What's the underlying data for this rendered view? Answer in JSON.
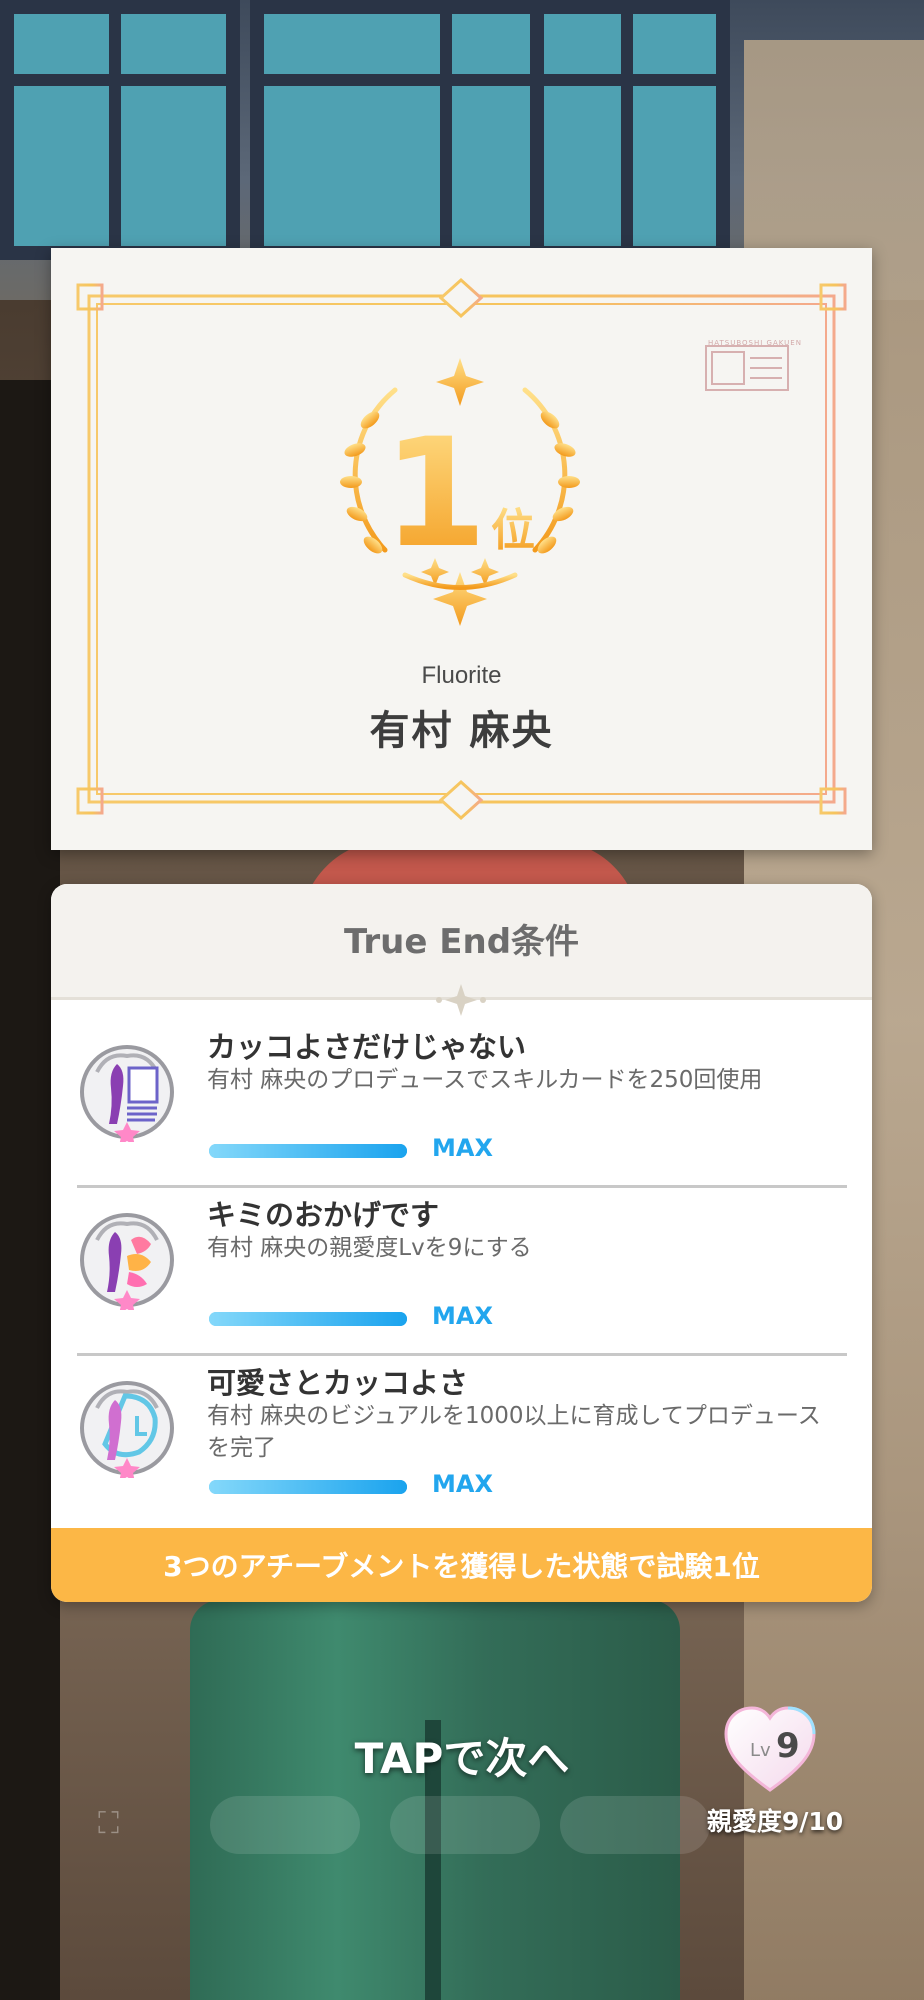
{
  "certificate": {
    "rank_number": "1",
    "rank_suffix": "位",
    "seal_text": "HATSUBOSHI GAKUEN",
    "subtitle": "Fluorite",
    "name": "有村 麻央"
  },
  "conditions": {
    "title": "True End条件",
    "items": [
      {
        "title": "カッコよさだけじゃない",
        "description": "有村 麻央のプロデュースでスキルカードを250回使用",
        "progress": 1.0,
        "status": "MAX",
        "icon": "card-achievement-icon"
      },
      {
        "title": "キミのおかげです",
        "description": "有村 麻央の親愛度Lvを9にする",
        "progress": 1.0,
        "status": "MAX",
        "icon": "heart-achievement-icon"
      },
      {
        "title": "可愛さとカッコよさ",
        "description": "有村 麻央のビジュアルを1000以上に育成してプロデュースを完了",
        "progress": 1.0,
        "status": "MAX",
        "icon": "visual-achievement-icon"
      }
    ],
    "footer": "3つのアチーブメントを獲得した状態で試験1位"
  },
  "controls": {
    "tap_prompt": "TAPで次へ",
    "affection_level_prefix": "Lv",
    "affection_level": "9",
    "affection_label": "親愛度9/10"
  },
  "colors": {
    "accent_gold": "#f5b12e",
    "progress_blue": "#22a6ee",
    "footer_orange": "#fcb746"
  }
}
